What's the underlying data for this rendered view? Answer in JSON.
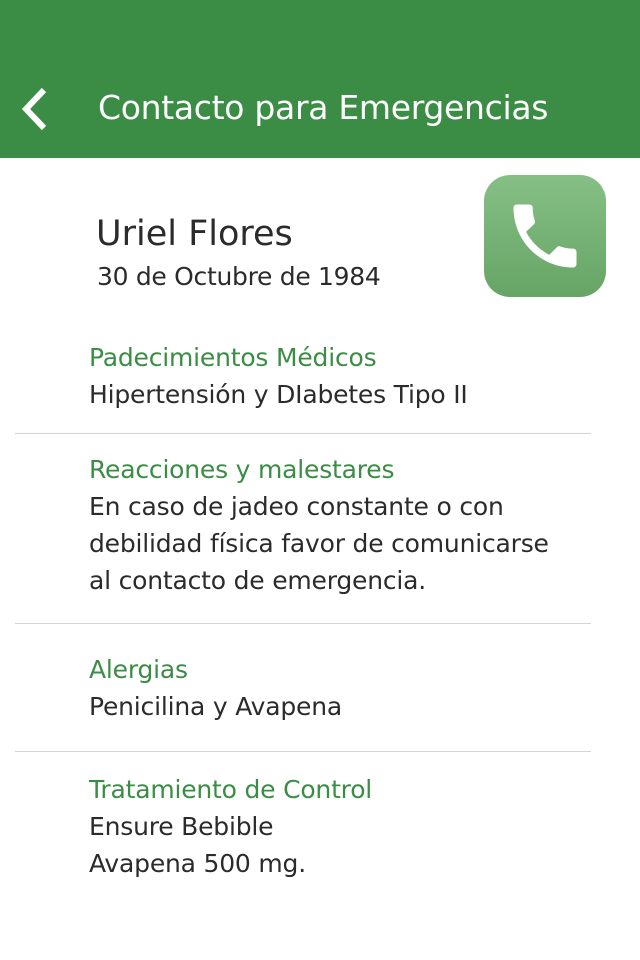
{
  "header": {
    "title": "Contacto para Emergencias",
    "back_icon": "chevron-left-icon",
    "background_color": "#3b8c45"
  },
  "profile": {
    "name": "Uriel Flores",
    "birth_date": "30 de Octubre de 1984",
    "call_icon": "phone-icon",
    "call_button_color": "#77b377"
  },
  "sections": [
    {
      "title": "Padecimientos Médicos",
      "lines": [
        "Hipertensión y DIabetes Tipo II"
      ]
    },
    {
      "title": "Reacciones y malestares",
      "lines": [
        "En caso de jadeo constante o con",
        "debilidad física favor de comunicarse",
        "al contacto de emergencia."
      ]
    },
    {
      "title": "Alergias",
      "lines": [
        "Penicilina y Avapena"
      ]
    },
    {
      "title": "Tratamiento de Control",
      "lines": [
        "Ensure Bebible",
        "Avapena 500 mg."
      ]
    }
  ],
  "colors": {
    "accent": "#3b8c45",
    "text": "#2b2b2b",
    "divider": "#d4d4d4"
  }
}
